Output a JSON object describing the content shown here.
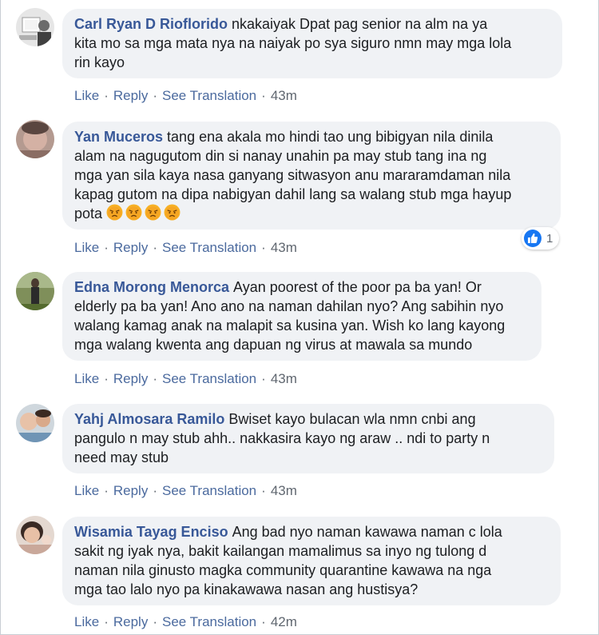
{
  "colors": {
    "author": "#385898",
    "action": "#4b6a9e",
    "bubble": "#f0f2f5",
    "like_blue": "#1877f2"
  },
  "comments": [
    {
      "author": "Carl Ryan D Rioflorido",
      "text": "nkakaiyak Dpat pag senior na alm na ya\nkita mo sa mga mata nya na naiyak po sya siguro nmn may mga lola\nrin kayo",
      "like": "Like",
      "reply": "Reply",
      "translate": "See Translation",
      "time": "43m"
    },
    {
      "author": "Yan Muceros",
      "text": "tang ena akala mo hindi tao ung bibigyan nila dinila\nalam na nagugutom din si nanay unahin pa may stub tang ina ng\nmga yan sila kaya nasa ganyang sitwasyon anu mararamdaman nila\nkapag gutom na dipa nabigyan dahil lang sa walang stub mga hayup\npota",
      "emoji": [
        "angry-face-icon",
        "angry-face-icon",
        "angry-face-icon",
        "angry-face-icon"
      ],
      "reaction_count": "1",
      "like": "Like",
      "reply": "Reply",
      "translate": "See Translation",
      "time": "43m"
    },
    {
      "author": "Edna Morong Menorca",
      "text": "Ayan poorest of the poor pa ba yan! Or\nelderly pa ba yan! Ano ano na naman dahilan nyo? Ang sabihin nyo\nwalang kamag anak na malapit sa kusina yan. Wish ko lang kayong\nmga walang kwenta ang dapuan ng virus at mawala sa mundo",
      "like": "Like",
      "reply": "Reply",
      "translate": "See Translation",
      "time": "43m"
    },
    {
      "author": "Yahj Almosara Ramilo",
      "text": "Bwiset kayo bulacan wla nmn cnbi ang\npangulo n may stub ahh.. nakkasira kayo ng araw .. ndi to party n\nneed may stub",
      "like": "Like",
      "reply": "Reply",
      "translate": "See Translation",
      "time": "43m"
    },
    {
      "author": "Wisamia Tayag Enciso",
      "text": "Ang bad nyo naman kawawa naman c lola\nsakit ng iyak nya, bakit kailangan mamalimus sa inyo ng tulong d\nnaman nila ginusto magka community quarantine kawawa na nga\nmga tao lalo nyo pa kinakawawa nasan ang hustisya?",
      "like": "Like",
      "reply": "Reply",
      "translate": "See Translation",
      "time": "42m"
    }
  ]
}
